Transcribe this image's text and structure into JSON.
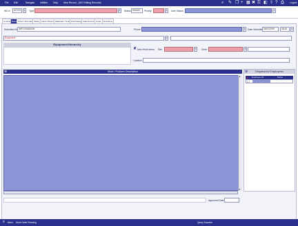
{
  "menu": {
    "items": [
      "File",
      "Edit",
      "Navigate",
      "Utilities",
      "Help"
    ],
    "record_title": "New Record - (WO Editing Records)",
    "logout": "Logout"
  },
  "header": {
    "wo_label": "WO #",
    "wo_value": "6270917",
    "type_label": "Type",
    "type_value": "",
    "status_label": "Status",
    "status_value": "WAMAT",
    "priority_label": "Priority",
    "priority_value": "",
    "user_status_label": "User Status",
    "user_status_value": ""
  },
  "tabs": [
    "Contract",
    "Basic",
    "Other Information",
    "Safety",
    "Labor Planning",
    "Materials / Tools",
    "Purchasing",
    "Attachments",
    "Costs",
    "Downtime"
  ],
  "active_tab_index": 1,
  "basic": {
    "submitted_by_label": "Submitted By",
    "submitted_by_value": "IMPCONADMIN",
    "phone_label": "Phone",
    "phone_value": "",
    "date_submitted_label": "Date Submitted",
    "date_submitted_value": "06/02/2009",
    "time_value": "08:48",
    "equipment_value": "Equipment",
    "equipment_hierarchy_title": "Equipment Hierarchy",
    "new_work_items_label": "New Work Items",
    "site_label": "Site",
    "site_value": "",
    "zone_label": "Zone",
    "zone_value": "",
    "location_label": "Location",
    "location_value": ""
  },
  "work_problem": {
    "title": "Work / Problem Description",
    "text": ""
  },
  "dispatched": {
    "title": "Dispatched Employees",
    "columns": [
      "Employee ID",
      "Name"
    ]
  },
  "approval": {
    "label": "Approved Date",
    "value": ""
  },
  "status_bar": {
    "menu_label": "Menu",
    "module_label": "Work Order Planning",
    "query_status": "Query Success"
  },
  "colors": {
    "primary": "#2a2f8c",
    "required_pink": "#efa0ac",
    "lookup_blue": "#8a94d6"
  }
}
